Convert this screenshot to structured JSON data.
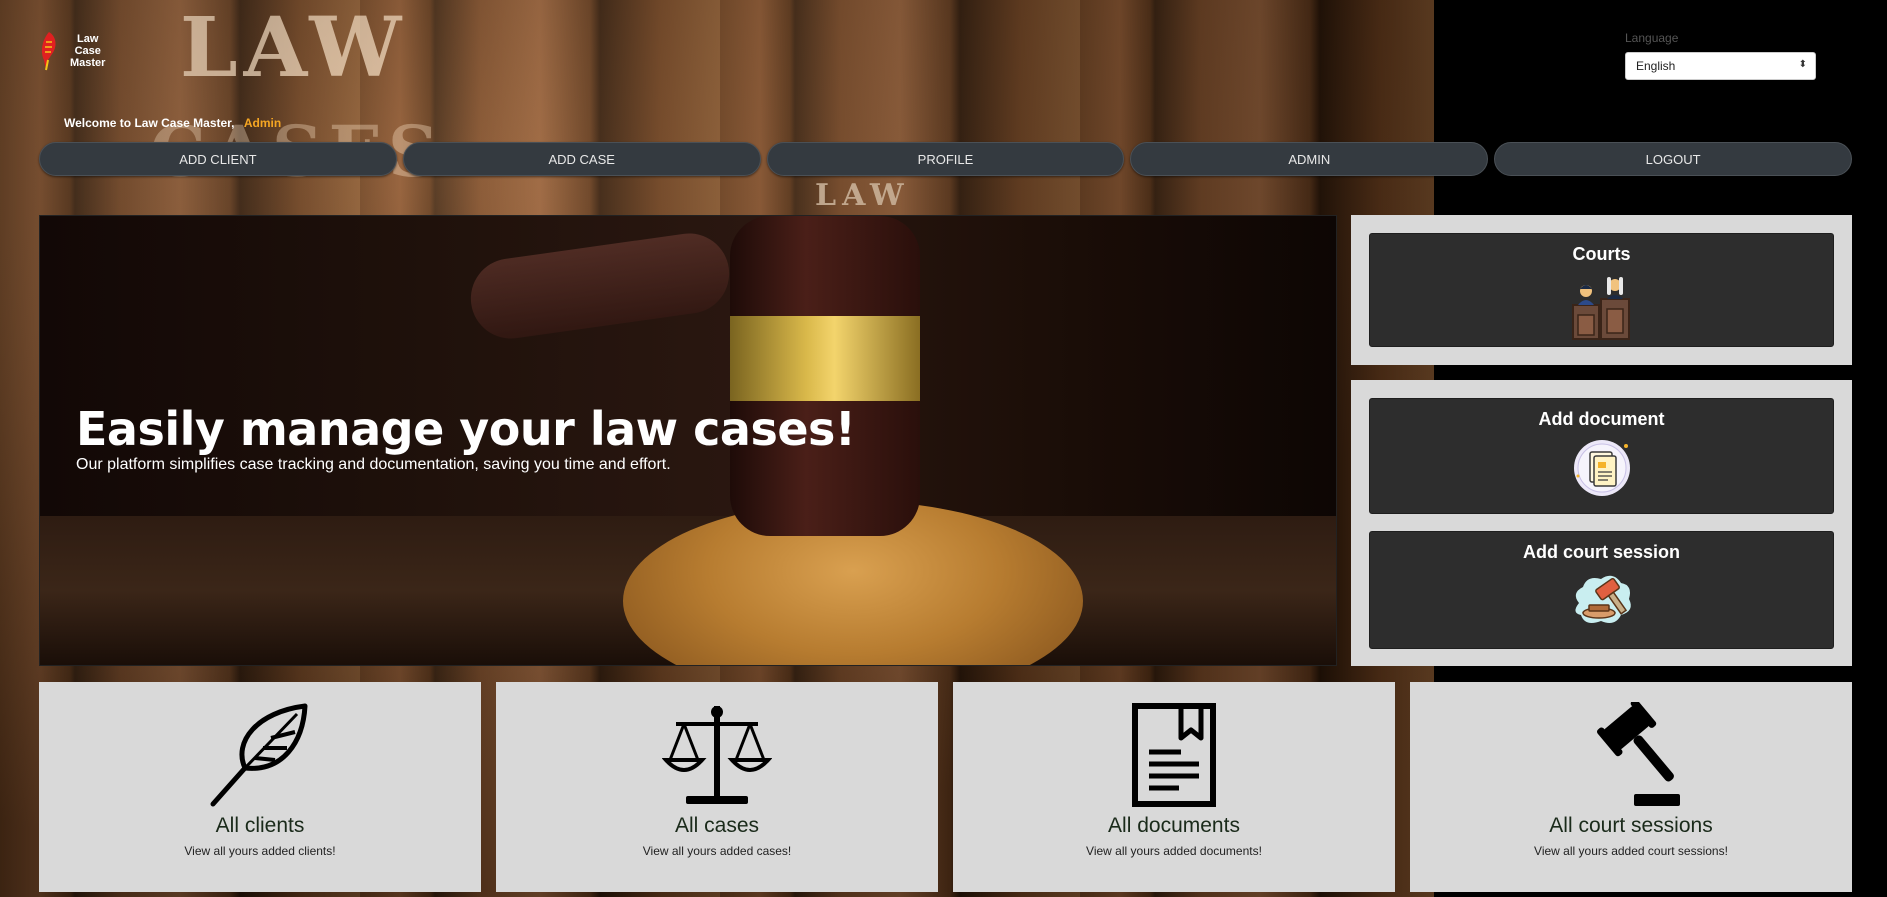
{
  "app": {
    "logo_text_1": "Law",
    "logo_text_2": "Case",
    "logo_text_3": "Master",
    "welcome_text": "Welcome to Law Case Master,",
    "username": "Admin"
  },
  "background": {
    "word_1": "LAW",
    "word_2": "CASES",
    "word_3": "LAW"
  },
  "language": {
    "label": "Language",
    "selected": "English"
  },
  "nav": [
    {
      "label": "ADD CLIENT"
    },
    {
      "label": "ADD CASE"
    },
    {
      "label": "PROFILE"
    },
    {
      "label": "ADMIN"
    },
    {
      "label": "LOGOUT"
    }
  ],
  "hero": {
    "title": "Easily manage your law cases!",
    "subtitle": "Our platform simplifies case tracking and documentation, saving you time and effort."
  },
  "side": {
    "courts": {
      "title": "Courts",
      "icon": "courtroom-icon"
    },
    "add_document": {
      "title": "Add document",
      "icon": "document-add-icon"
    },
    "add_session": {
      "title": "Add court session",
      "icon": "gavel-session-icon"
    }
  },
  "cards": [
    {
      "title": "All clients",
      "subtitle": "View all yours added clients!",
      "icon": "feather-icon"
    },
    {
      "title": "All cases",
      "subtitle": "View all yours added cases!",
      "icon": "scales-icon"
    },
    {
      "title": "All documents",
      "subtitle": "View all yours added documents!",
      "icon": "document-icon"
    },
    {
      "title": "All court sessions",
      "subtitle": "View all yours added court sessions!",
      "icon": "gavel-icon"
    }
  ],
  "colors": {
    "accent_user": "#f5a623",
    "nav_bg": "#343a40",
    "card_bg": "#d9d9d9",
    "side_card_bg": "#2d2d2d"
  }
}
